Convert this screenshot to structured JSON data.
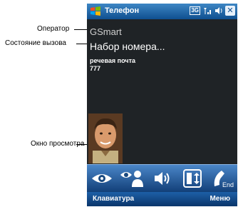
{
  "callouts": {
    "operator": "Оператор",
    "call_state": "Состояние вызова",
    "preview": "Окно просмотра"
  },
  "titlebar": {
    "title": "Телефон",
    "network": "3G",
    "signal_icon": "signal-icon",
    "volume_icon": "volume-icon",
    "close_label": "✕"
  },
  "main": {
    "operator": "GSmart",
    "call_state": "Набор номера...",
    "voicemail_label": "речевая почта",
    "voicemail_number": "777"
  },
  "callbar": {
    "buttons": [
      "eye-icon",
      "contact-view-icon",
      "speaker-icon",
      "swap-icon",
      "end-call-icon"
    ],
    "end_label": "End"
  },
  "softkeys": {
    "left": "Клавиатура",
    "right": "Меню"
  }
}
